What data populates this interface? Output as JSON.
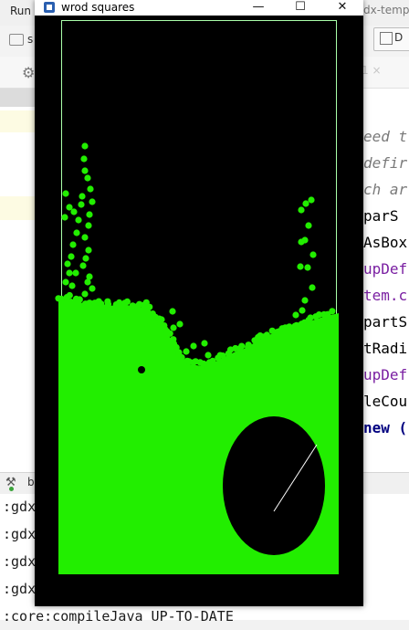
{
  "ide": {
    "menu_run": "Run",
    "title_fragment": "dx-temp",
    "nav_folder_text": "s",
    "nav_right_text": "D",
    "toolbar_right_fragment": "1 ×",
    "code_lines": [
      {
        "text": "eed t",
        "color": "#7a7a7a",
        "style": "italic"
      },
      {
        "text": "defir",
        "color": "#7a7a7a",
        "style": "italic"
      },
      {
        "text": "ch ar",
        "color": "#7a7a7a",
        "style": "italic"
      },
      {
        "text": " parS",
        "color": "#000000",
        "style": "normal"
      },
      {
        "text": "AsBox",
        "color": "#000000",
        "style": "normal"
      },
      {
        "text": "upDef",
        "color": "#7a1fa2",
        "style": "normal"
      },
      {
        "text": "tem.c",
        "color": "#7a1fa2",
        "style": "normal"
      },
      {
        "text": "partS",
        "color": "#000000",
        "style": "normal"
      },
      {
        "text": "tRadi",
        "color": "#000000",
        "style": "normal"
      },
      {
        "text": "upDef",
        "color": "#7a1fa2",
        "style": "normal"
      },
      {
        "text": "leCou",
        "color": "#000000",
        "style": "normal"
      },
      {
        "text": "new (",
        "color": "#000080",
        "style": "bold"
      }
    ],
    "build_label": "b",
    "console_lines": [
      ":gdx",
      ":gdx",
      ":gdx",
      ":gdx",
      ":core:compileJava UP-TO-DATE"
    ]
  },
  "game_window": {
    "title": "wrod squares",
    "minimize_label": "—",
    "maximize_label": "☐",
    "close_label": "✕",
    "colors": {
      "background": "#000000",
      "particles": "#22ee00",
      "boundary": "#aaffaa",
      "radius_line": "#ffffff"
    }
  }
}
